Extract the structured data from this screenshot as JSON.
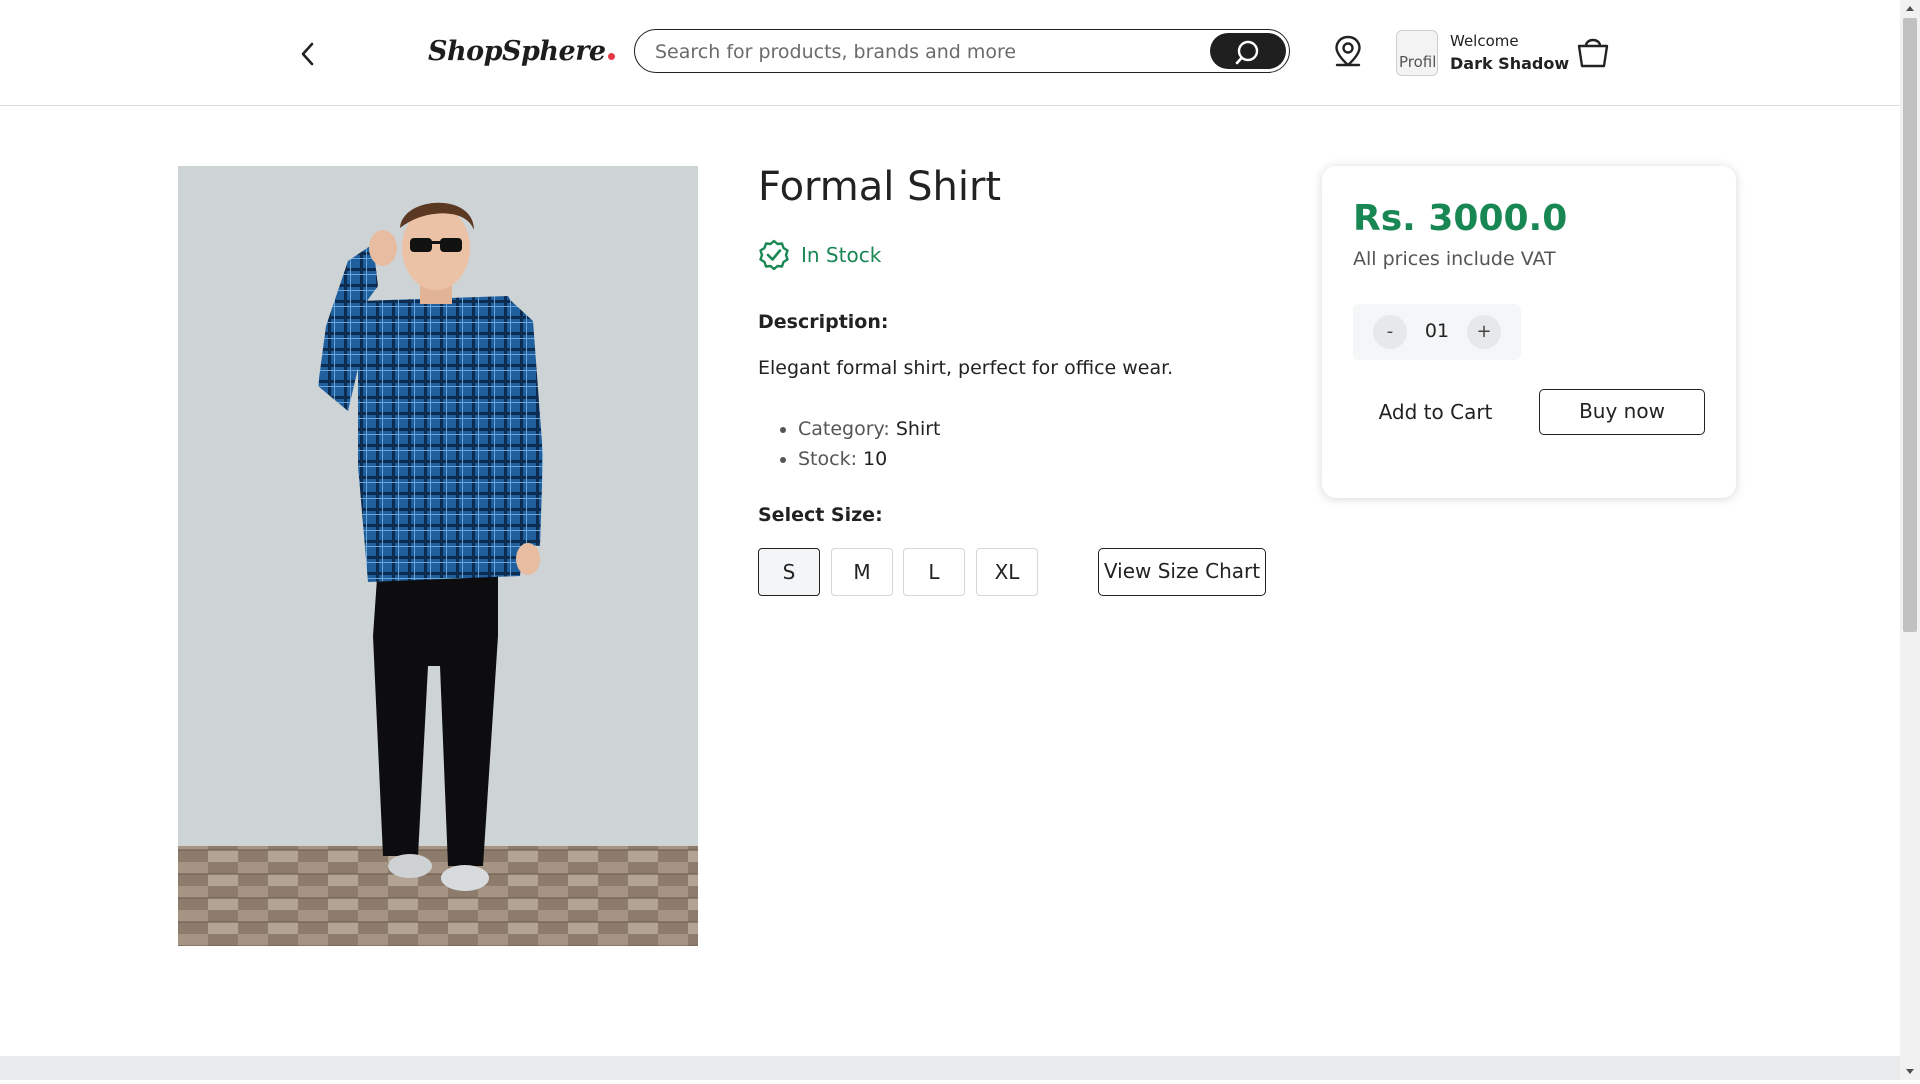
{
  "header": {
    "logo_text": "ShopSphere",
    "logo_dot_color": "#e63946",
    "search_placeholder": "Search for products, brands and more",
    "search_icon": "search-icon",
    "location_icon": "location-pin-icon",
    "avatar_alt": "Profile",
    "welcome_text": "Welcome",
    "user_name": "Dark Shadow",
    "cart_icon": "shopping-bag-icon",
    "back_icon": "chevron-left-icon"
  },
  "product": {
    "title": "Formal Shirt",
    "stock_status": "In Stock",
    "stock_color": "#198754",
    "description_heading": "Description:",
    "description": "Elegant formal shirt, perfect for office wear.",
    "meta": [
      {
        "label": "Category:",
        "value": "Shirt"
      },
      {
        "label": "Stock:",
        "value": "10"
      }
    ],
    "size_heading": "Select Size:",
    "sizes": [
      "S",
      "M",
      "L",
      "XL"
    ],
    "selected_size": "S",
    "size_chart_label": "View Size Chart"
  },
  "purchase": {
    "price": "Rs. 3000.0",
    "price_color": "#198754",
    "vat_note": "All prices include VAT",
    "qty_minus": "-",
    "qty_value": "01",
    "qty_plus": "+",
    "add_to_cart_label": "Add to Cart",
    "buy_now_label": "Buy now"
  }
}
